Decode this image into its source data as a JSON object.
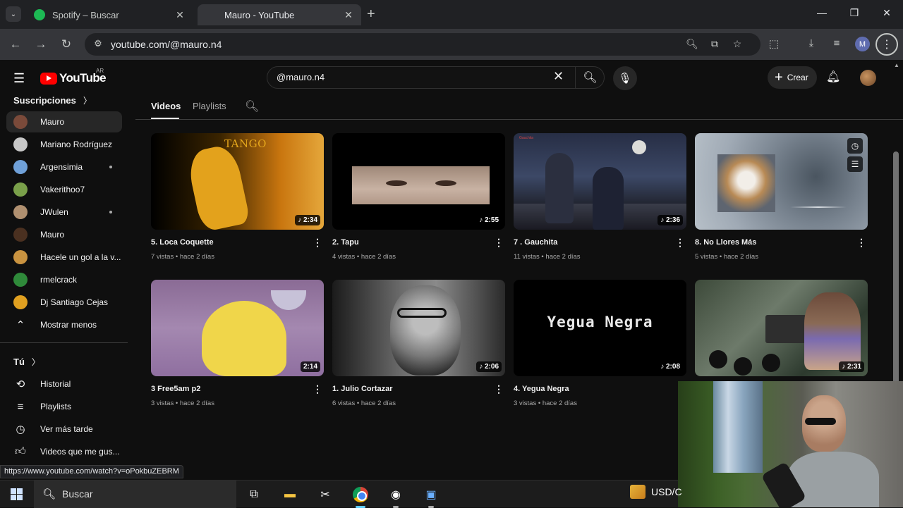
{
  "browser": {
    "tabs": [
      {
        "title": "Spotify – Buscar",
        "icon": "spotify-icon",
        "active": false
      },
      {
        "title": "Mauro - YouTube",
        "icon": "youtube-icon",
        "active": true
      }
    ],
    "url": "youtube.com/@mauro.n4",
    "profile_initial": "M",
    "status_url": "https://www.youtube.com/watch?v=oPokbuZEBRM"
  },
  "youtube": {
    "logo_text": "YouTube",
    "country_code": "AR",
    "search_value": "@mauro.n4",
    "create_label": "Crear"
  },
  "sidebar": {
    "subscriptions_heading": "Suscripciones",
    "subscriptions": [
      {
        "name": "Mauro",
        "selected": true,
        "dot": false,
        "color": "#7a4a3a"
      },
      {
        "name": "Mariano Rodríguez",
        "selected": false,
        "dot": false,
        "color": "#c8c8c8"
      },
      {
        "name": "Argensimia",
        "selected": false,
        "dot": true,
        "color": "#6fa0d8"
      },
      {
        "name": "Vakerithoo7",
        "selected": false,
        "dot": false,
        "color": "#7aa04a"
      },
      {
        "name": "JWulen",
        "selected": false,
        "dot": true,
        "color": "#b09070"
      },
      {
        "name": "Mauro",
        "selected": false,
        "dot": false,
        "color": "#4a3020"
      },
      {
        "name": "Hacele un gol a la v...",
        "selected": false,
        "dot": false,
        "color": "#c99340"
      },
      {
        "name": "rmelcrack",
        "selected": false,
        "dot": false,
        "color": "#2f8a3a"
      },
      {
        "name": "Dj Santiago Cejas",
        "selected": false,
        "dot": false,
        "color": "#e0a020"
      }
    ],
    "show_less": "Mostrar menos",
    "you_heading": "Tú",
    "you_items": [
      {
        "label": "Historial",
        "icon": "history-icon"
      },
      {
        "label": "Playlists",
        "icon": "playlists-icon"
      },
      {
        "label": "Ver más tarde",
        "icon": "watch-later-icon"
      },
      {
        "label": "Videos que me gus...",
        "icon": "like-icon"
      }
    ]
  },
  "channel_tabs": [
    "Videos",
    "Playlists"
  ],
  "videos": [
    {
      "title": "5. Loca Coquette",
      "views": "7 vistas",
      "age": "hace 2 días",
      "duration": "2:34",
      "music": true
    },
    {
      "title": "2. Tapu",
      "views": "4 vistas",
      "age": "hace 2 días",
      "duration": "2:55",
      "music": true
    },
    {
      "title": "7 . Gauchita",
      "views": "11 vistas",
      "age": "hace 2 días",
      "duration": "2:36",
      "music": true
    },
    {
      "title": "8. No Llores Más",
      "views": "5 vistas",
      "age": "hace 2 días",
      "duration": "",
      "music": false
    },
    {
      "title": "3 Free5am p2",
      "views": "3 vistas",
      "age": "hace 2 días",
      "duration": "2:14",
      "music": false
    },
    {
      "title": "1. Julio Cortazar",
      "views": "6 vistas",
      "age": "hace 2 días",
      "duration": "2:06",
      "music": true
    },
    {
      "title": "4. Yegua Negra",
      "views": "3 vistas",
      "age": "hace 2 días",
      "duration": "2:08",
      "music": true
    },
    {
      "title": "",
      "views": "",
      "age": "",
      "duration": "2:31",
      "music": true
    }
  ],
  "thumb_text": {
    "tango": "TANGO",
    "gauchita_tag": "Gauchita",
    "yegua": "Yegua Negra"
  },
  "taskbar": {
    "search_placeholder": "Buscar",
    "ticker": "USD/C"
  }
}
